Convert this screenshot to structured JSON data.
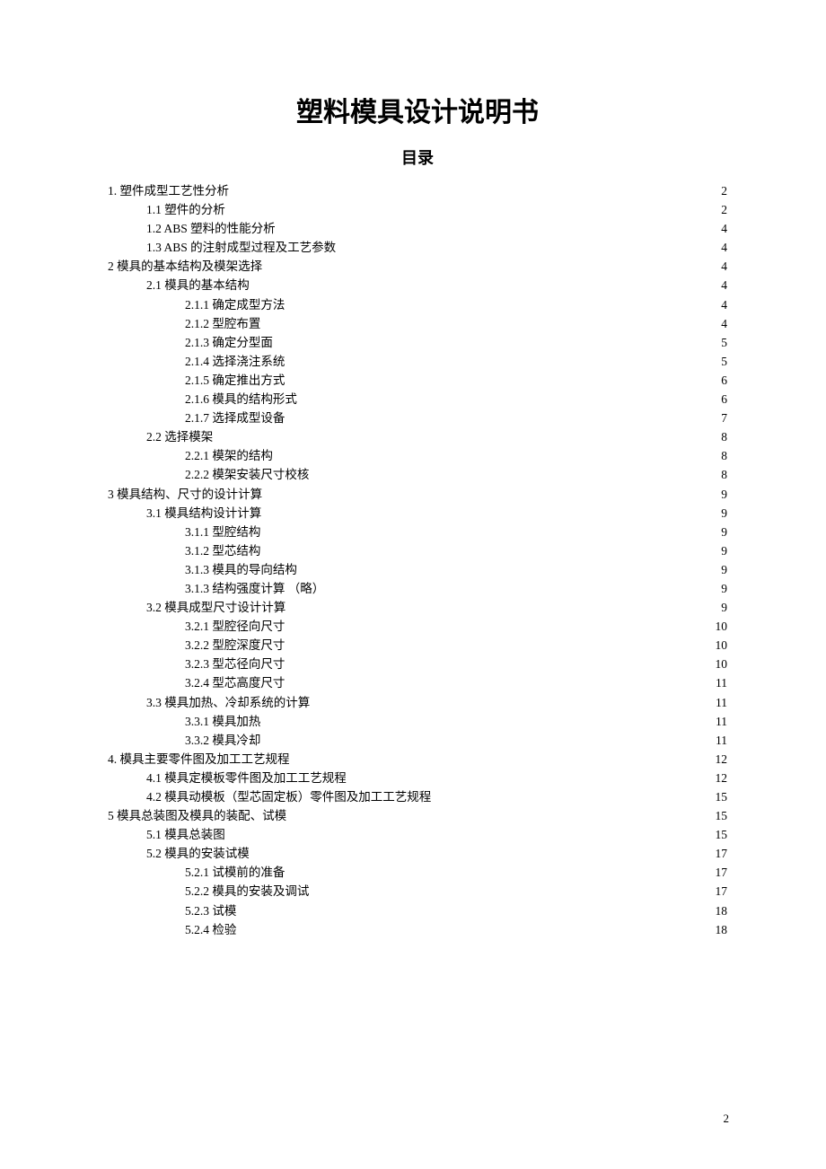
{
  "title": "塑料模具设计说明书",
  "subtitle": "目录",
  "page_number": "2",
  "toc": [
    {
      "indent": 0,
      "label": "1. 塑件成型工艺性分析",
      "page": "2"
    },
    {
      "indent": 1,
      "label": "1.1 塑件的分析",
      "page": "2"
    },
    {
      "indent": 1,
      "label": "1.2 ABS 塑料的性能分析",
      "page": "4"
    },
    {
      "indent": 1,
      "label": "1.3 ABS 的注射成型过程及工艺参数 ",
      "page": "4"
    },
    {
      "indent": 0,
      "label": "2  模具的基本结构及模架选择",
      "page": "4"
    },
    {
      "indent": 1,
      "label": "2.1  模具的基本结构",
      "page": "4"
    },
    {
      "indent": 2,
      "label": "2.1.1  确定成型方法",
      "page": "4"
    },
    {
      "indent": 2,
      "label": "2.1.2  型腔布置",
      "page": "4"
    },
    {
      "indent": 2,
      "label": "2.1.3  确定分型面",
      "page": "5"
    },
    {
      "indent": 2,
      "label": "2.1.4  选择浇注系统",
      "page": "5"
    },
    {
      "indent": 2,
      "label": "2.1.5  确定推出方式",
      "page": "6"
    },
    {
      "indent": 2,
      "label": "2.1.6  模具的结构形式",
      "page": "6"
    },
    {
      "indent": 2,
      "label": "2.1.7 选择成型设备",
      "page": "7"
    },
    {
      "indent": 1,
      "label": "2.2  选择模架",
      "page": "8"
    },
    {
      "indent": 2,
      "label": "2.2.1  模架的结构",
      "page": "8"
    },
    {
      "indent": 2,
      "label": "2.2.2  模架安装尺寸校核",
      "page": "8"
    },
    {
      "indent": 0,
      "label": "3  模具结构、尺寸的设计计算",
      "page": "9"
    },
    {
      "indent": 1,
      "label": "3.1  模具结构设计计算",
      "page": "9"
    },
    {
      "indent": 2,
      "label": "3.1.1  型腔结构",
      "page": "9"
    },
    {
      "indent": 2,
      "label": "3.1.2  型芯结构",
      "page": "9"
    },
    {
      "indent": 2,
      "label": "3.1.3  模具的导向结构",
      "page": "9"
    },
    {
      "indent": 2,
      "label": "3.1.3  结构强度计算   （略）",
      "page": "9"
    },
    {
      "indent": 1,
      "label": "3.2  模具成型尺寸设计计算",
      "page": "9"
    },
    {
      "indent": 2,
      "label": "3.2.1  型腔径向尺寸",
      "page": "10"
    },
    {
      "indent": 2,
      "label": "3.2.2  型腔深度尺寸",
      "page": "10"
    },
    {
      "indent": 2,
      "label": "3.2.3  型芯径向尺寸",
      "page": "10"
    },
    {
      "indent": 2,
      "label": "3.2.4 型芯高度尺寸",
      "page": "11"
    },
    {
      "indent": 1,
      "label": "3.3  模具加热、冷却系统的计算",
      "page": "11"
    },
    {
      "indent": 2,
      "label": "3.3.1  模具加热",
      "page": "11"
    },
    {
      "indent": 2,
      "label": "3.3.2  模具冷却",
      "page": "11"
    },
    {
      "indent": 0,
      "label": "4. 模具主要零件图及加工工艺规程",
      "page": "12"
    },
    {
      "indent": 1,
      "label": "4.1  模具定模板零件图及加工工艺规程",
      "page": "12"
    },
    {
      "indent": 1,
      "label": "4.2  模具动模板（型芯固定板）零件图及加工工艺规程",
      "page": "15"
    },
    {
      "indent": 0,
      "label": "5  模具总装图及模具的装配、试模",
      "page": "15"
    },
    {
      "indent": 1,
      "label": "5.1  模具总装图",
      "page": "15"
    },
    {
      "indent": 1,
      "label": "5.2  模具的安装试模",
      "page": "17"
    },
    {
      "indent": 2,
      "label": "5.2.1  试模前的准备",
      "page": "17"
    },
    {
      "indent": 2,
      "label": "5.2.2  模具的安装及调试",
      "page": "17"
    },
    {
      "indent": 2,
      "label": "5.2.3  试模",
      "page": "18"
    },
    {
      "indent": 2,
      "label": "5.2.4 检验",
      "page": "18"
    }
  ]
}
